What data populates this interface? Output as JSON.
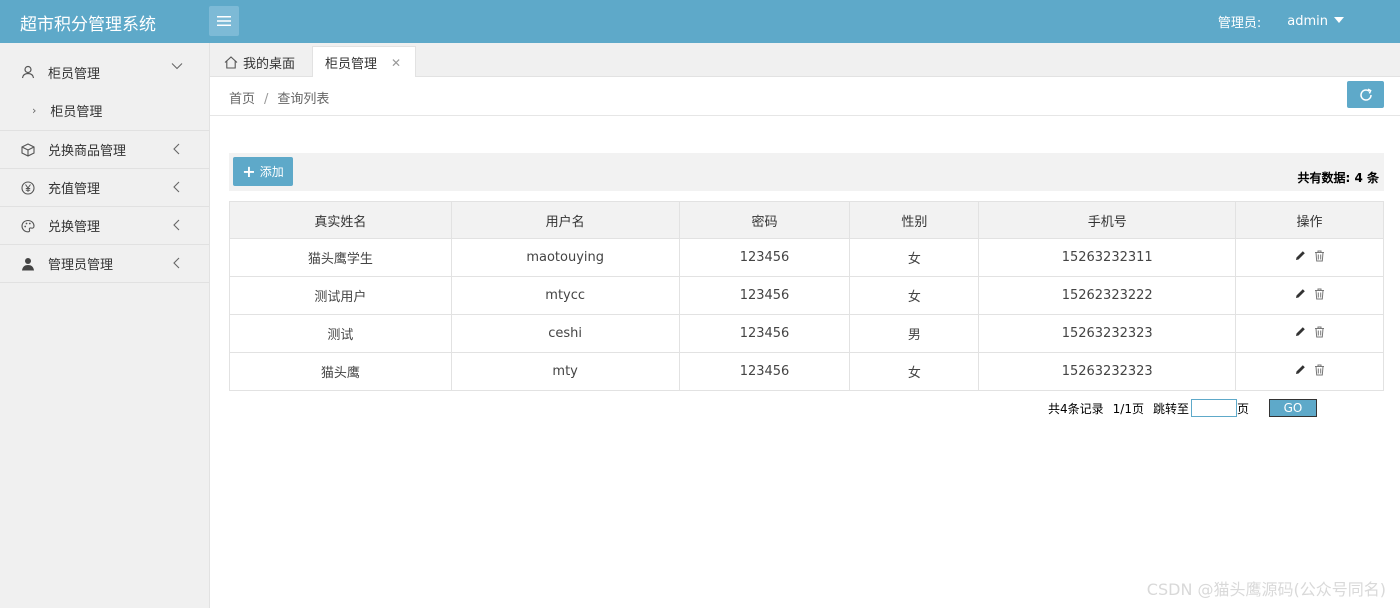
{
  "header": {
    "title": "超市积分管理系统",
    "role_label": "管理员:",
    "username": "admin"
  },
  "sidebar": {
    "items": [
      {
        "label": "柜员管理",
        "icon": "user-icon",
        "expanded": true,
        "children": [
          {
            "label": "柜员管理"
          }
        ]
      },
      {
        "label": "兑换商品管理",
        "icon": "box-icon"
      },
      {
        "label": "充值管理",
        "icon": "yen-icon"
      },
      {
        "label": "兑换管理",
        "icon": "palette-icon"
      },
      {
        "label": "管理员管理",
        "icon": "admin-user-icon"
      }
    ]
  },
  "tabs": {
    "home_label": "我的桌面",
    "active_label": "柜员管理"
  },
  "breadcrumb": {
    "home": "首页",
    "separator": "/",
    "current": "查询列表"
  },
  "toolbar": {
    "add_label": "添加",
    "total_label": "共有数据:",
    "total_count": "4",
    "total_unit": "条"
  },
  "table": {
    "columns": [
      "真实姓名",
      "用户名",
      "密码",
      "性别",
      "手机号",
      "操作"
    ],
    "rows": [
      {
        "real_name": "猫头鹰学生",
        "username": "maotouying",
        "password": "123456",
        "gender": "女",
        "phone": "15263232311"
      },
      {
        "real_name": "测试用户",
        "username": "mtycc",
        "password": "123456",
        "gender": "女",
        "phone": "15262323222"
      },
      {
        "real_name": "测试",
        "username": "ceshi",
        "password": "123456",
        "gender": "男",
        "phone": "15263232323"
      },
      {
        "real_name": "猫头鹰",
        "username": "mty",
        "password": "123456",
        "gender": "女",
        "phone": "15263232323"
      }
    ]
  },
  "pager": {
    "records": "共4条记录",
    "pages": "1/1页",
    "jump_label": "跳转至",
    "page_suffix": "页",
    "go_label": "GO",
    "jump_value": ""
  },
  "watermark": "CSDN @猫头鹰源码(公众号同名)",
  "colors": {
    "accent": "#5ea9c9",
    "sidebar_bg": "#f0f0f0",
    "table_header_bg": "#f2f2f2"
  }
}
